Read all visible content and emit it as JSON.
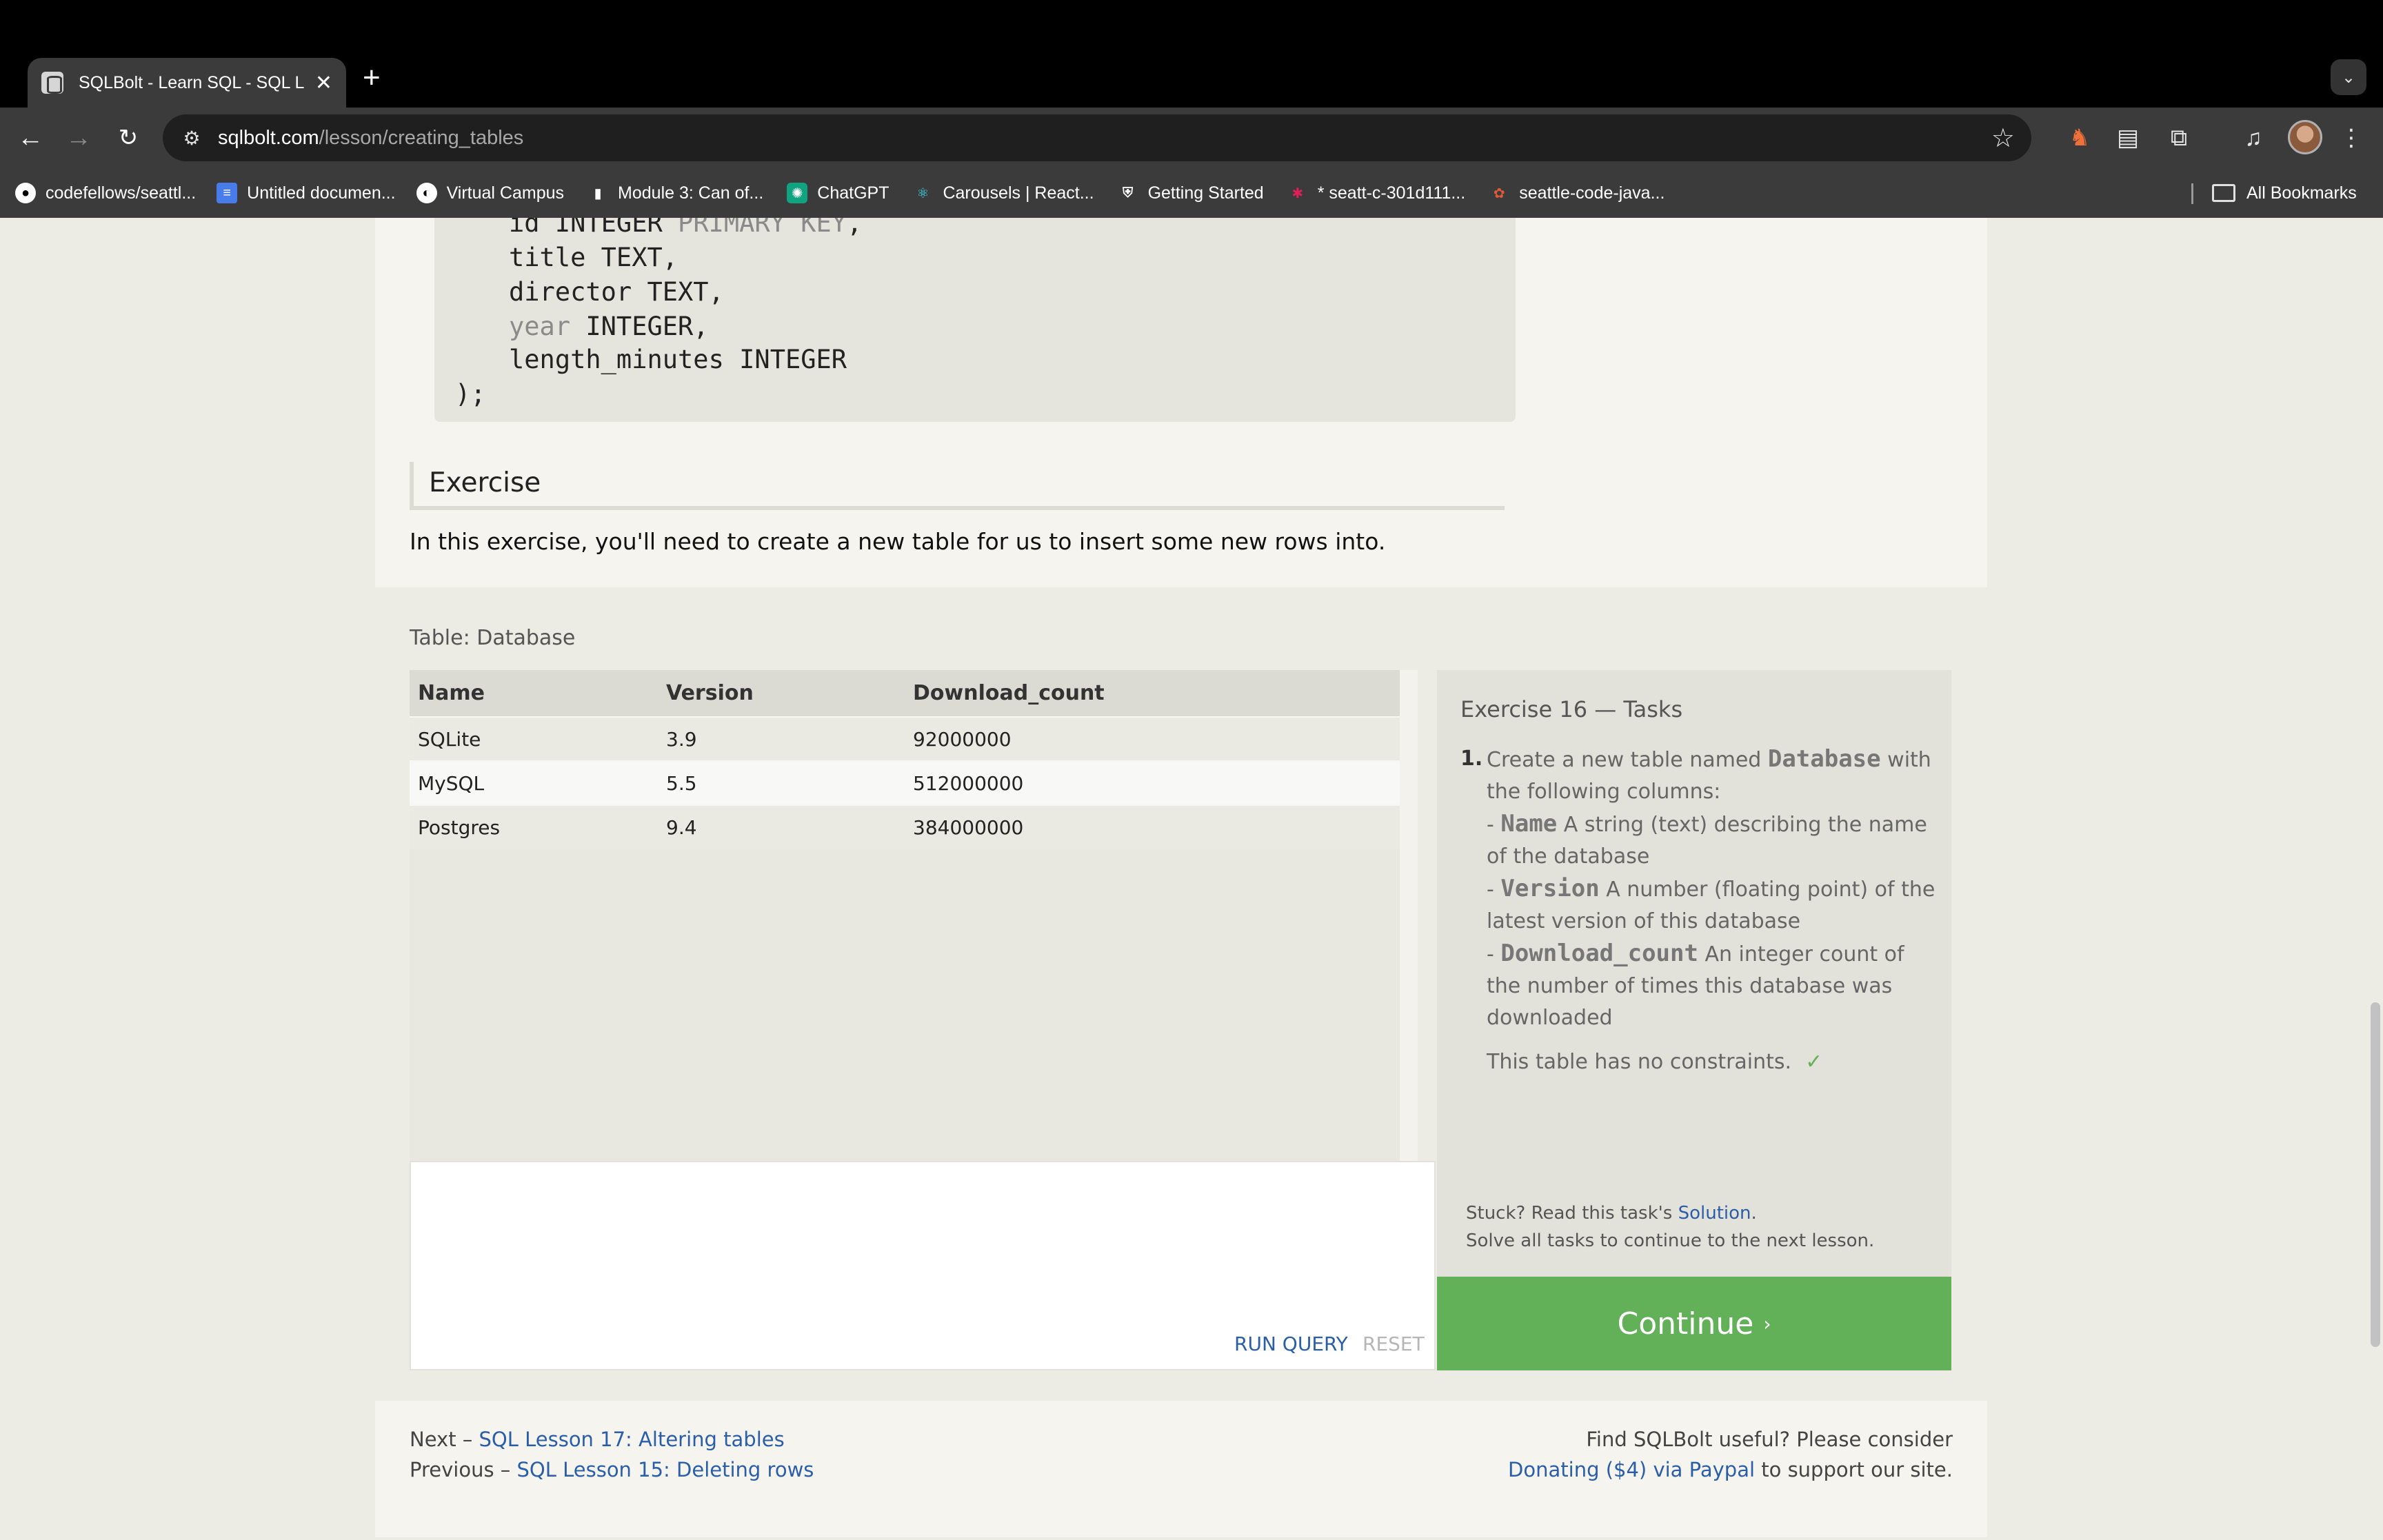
{
  "browser": {
    "tab_title": "SQLBolt - Learn SQL - SQL L",
    "new_tab": "+",
    "url_host": "sqlbolt.com",
    "url_path": "/lesson/creating_tables",
    "bookmarks": [
      {
        "label": "codefellows/seattl...",
        "icon": "github-icon"
      },
      {
        "label": "Untitled documen...",
        "icon": "docs-icon"
      },
      {
        "label": "Virtual Campus",
        "icon": "globe-icon"
      },
      {
        "label": "Module 3: Can of...",
        "icon": "book-icon"
      },
      {
        "label": "ChatGPT",
        "icon": "chatgpt-icon"
      },
      {
        "label": "Carousels | React...",
        "icon": "react-bootstrap-icon"
      },
      {
        "label": "Getting Started",
        "icon": "shield-icon"
      },
      {
        "label": "* seatt-c-301d111...",
        "icon": "slack-icon"
      },
      {
        "label": "seattle-code-java...",
        "icon": "codefellows-icon"
      }
    ],
    "all_bookmarks": "All Bookmarks"
  },
  "code": {
    "lines": [
      "id INTEGER PRIMARY KEY,",
      "title TEXT,",
      "director TEXT,",
      "year INTEGER,",
      "length_minutes INTEGER",
      ");"
    ]
  },
  "exercise": {
    "heading": "Exercise",
    "intro": "In this exercise, you'll need to create a new table for us to insert some new rows into.",
    "table_caption": "Table: Database",
    "columns": [
      "Name",
      "Version",
      "Download_count"
    ],
    "rows": [
      [
        "SQLite",
        "3.9",
        "92000000"
      ],
      [
        "MySQL",
        "5.5",
        "512000000"
      ],
      [
        "Postgres",
        "9.4",
        "384000000"
      ]
    ],
    "editor_value": "",
    "run_query": "RUN QUERY",
    "reset": "RESET"
  },
  "tasks": {
    "title": "Exercise 16 — Tasks",
    "num": "1.",
    "intro_pre": "Create a new table named ",
    "intro_table": "Database",
    "intro_post": " with the following columns:",
    "cols": [
      {
        "dash": "- ",
        "name": "Name",
        "desc": " A string (text) describing the name of the database"
      },
      {
        "dash": "- ",
        "name": "Version",
        "desc": " A number (floating point) of the latest version of this database"
      },
      {
        "dash": "- ",
        "name": "Download_count",
        "desc": " An integer count of the number of times this database was downloaded"
      }
    ],
    "constraints": "This table has no constraints.",
    "check": "✓",
    "stuck_pre": "Stuck? Read this task's ",
    "solution": "Solution",
    "stuck_post": ".",
    "solve_all": "Solve all tasks to continue to the next lesson.",
    "continue": "Continue",
    "continue_chev": "›"
  },
  "footer": {
    "next_label": "Next – ",
    "next_link": "SQL Lesson 17: Altering tables",
    "prev_label": "Previous – ",
    "prev_link": "SQL Lesson 15: Deleting rows",
    "useful": "Find SQLBolt useful? Please consider",
    "donate_link": "Donating ($4) via Paypal",
    "donate_post": " to support our site."
  }
}
